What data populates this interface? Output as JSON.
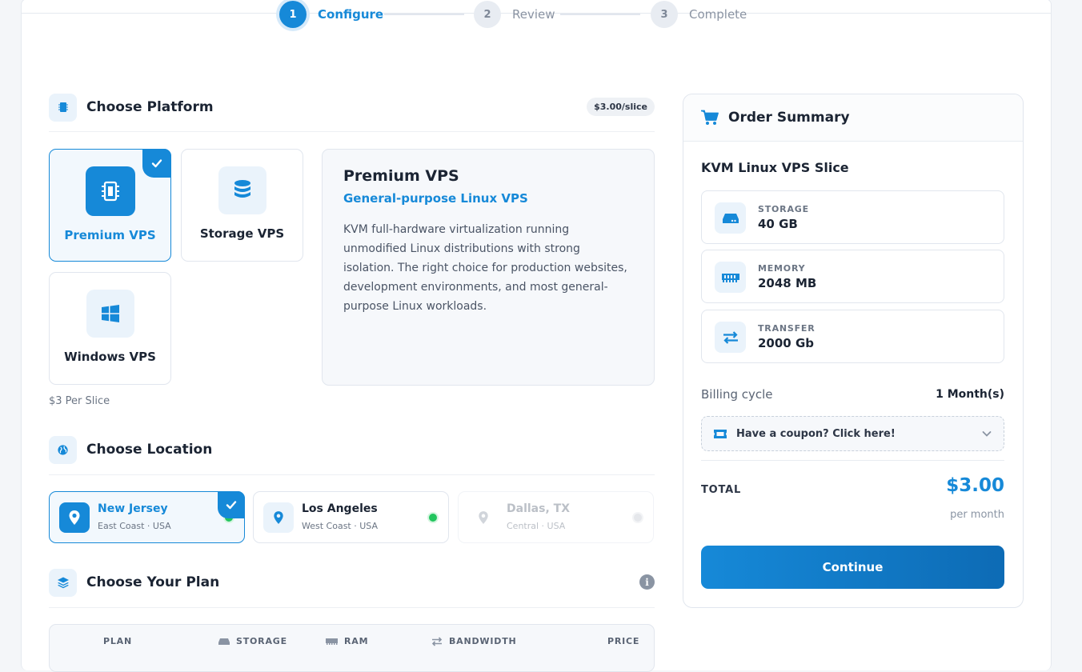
{
  "stepper": {
    "steps": [
      {
        "num": "1",
        "label": "Configure"
      },
      {
        "num": "2",
        "label": "Review"
      },
      {
        "num": "3",
        "label": "Complete"
      }
    ]
  },
  "platform": {
    "title": "Choose Platform",
    "price_badge": "$3.00/slice",
    "options": [
      {
        "label": "Premium VPS",
        "icon": "chip-icon",
        "selected": true
      },
      {
        "label": "Storage VPS",
        "icon": "database-icon",
        "selected": false
      },
      {
        "label": "Windows VPS",
        "icon": "windows-icon",
        "selected": false
      }
    ],
    "detail": {
      "title": "Premium VPS",
      "subtitle": "General-purpose Linux VPS",
      "description": "KVM full-hardware virtualization running unmodified Linux distributions with strong isolation. The right choice for production websites, development environments, and most general-purpose Linux workloads."
    },
    "per_slice_note": "$3 Per Slice"
  },
  "location": {
    "title": "Choose Location",
    "options": [
      {
        "name": "New Jersey",
        "sub": "East Coast · USA",
        "selected": true,
        "available": true
      },
      {
        "name": "Los Angeles",
        "sub": "West Coast · USA",
        "selected": false,
        "available": true
      },
      {
        "name": "Dallas, TX",
        "sub": "Central · USA",
        "selected": false,
        "available": false
      }
    ]
  },
  "plan": {
    "title": "Choose Your Plan",
    "columns": [
      "PLAN",
      "STORAGE",
      "RAM",
      "BANDWIDTH",
      "PRICE"
    ]
  },
  "summary": {
    "title": "Order Summary",
    "product": "KVM Linux VPS Slice",
    "specs": [
      {
        "label": "STORAGE",
        "value": "40 GB",
        "icon": "drive-icon"
      },
      {
        "label": "MEMORY",
        "value": "2048 MB",
        "icon": "memory-icon"
      },
      {
        "label": "TRANSFER",
        "value": "2000 Gb",
        "icon": "transfer-icon"
      }
    ],
    "billing_label": "Billing cycle",
    "billing_value": "1 Month(s)",
    "coupon_label": "Have a coupon? Click here!",
    "total_label": "TOTAL",
    "total_value": "$3.00",
    "total_period": "per month",
    "continue_label": "Continue"
  },
  "colors": {
    "accent": "#1689d8",
    "online": "#22c55e"
  }
}
